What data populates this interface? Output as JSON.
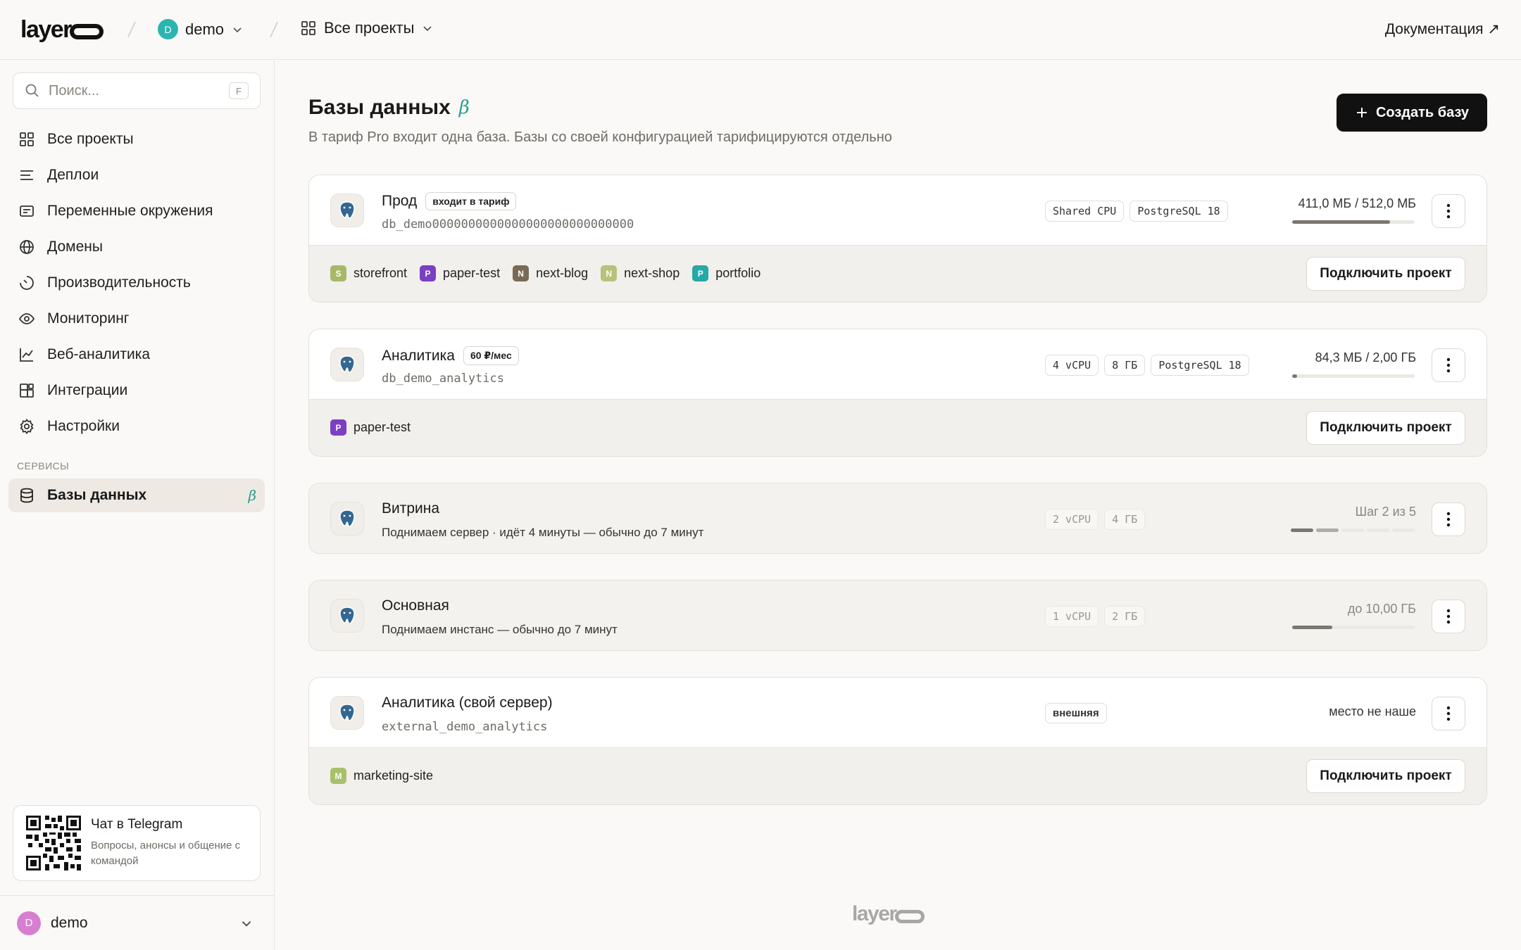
{
  "header": {
    "logo": "layero",
    "workspace": {
      "initial": "D",
      "name": "demo",
      "color": "#2bb5b0"
    },
    "projects_label": "Все проекты",
    "docs_label": "Документация ↗"
  },
  "sidebar": {
    "search_placeholder": "Поиск...",
    "search_shortcut": "F",
    "items": [
      {
        "label": "Все проекты",
        "icon": "grid-icon"
      },
      {
        "label": "Деплои",
        "icon": "list-icon"
      },
      {
        "label": "Переменные окружения",
        "icon": "env-icon"
      },
      {
        "label": "Домены",
        "icon": "globe-icon"
      },
      {
        "label": "Производительность",
        "icon": "gauge-icon"
      },
      {
        "label": "Мониторинг",
        "icon": "eye-icon"
      },
      {
        "label": "Веб-аналитика",
        "icon": "chart-icon"
      },
      {
        "label": "Интеграции",
        "icon": "integrations-icon"
      },
      {
        "label": "Настройки",
        "icon": "gear-icon"
      }
    ],
    "section_label": "СЕРВИСЫ",
    "active_item": {
      "label": "Базы данных",
      "beta": "β",
      "icon": "database-icon"
    },
    "telegram": {
      "title": "Чат в Telegram",
      "subtitle": "Вопросы, анонсы и общение с командой"
    },
    "user": {
      "initial": "D",
      "name": "demo",
      "color": "#d67fd0"
    }
  },
  "main": {
    "title": "Базы данных",
    "beta": "β",
    "subtitle": "В тариф Pro входит одна база. Базы со своей конфигурацией тарифицируются отдельно",
    "create_label": "Создать базу",
    "connect_label": "Подключить проект",
    "databases": [
      {
        "name": "Прод",
        "badge": "входит в тариф",
        "db_id": "db_demo0000000000000000000000000000",
        "tags": [
          "Shared CPU",
          "PostgreSQL 18"
        ],
        "usage": "411,0 МБ / 512,0 МБ",
        "usage_fraction": 0.8,
        "projects": [
          {
            "initial": "S",
            "name": "storefront",
            "color": "#a8b86a"
          },
          {
            "initial": "P",
            "name": "paper-test",
            "color": "#7b3fc4"
          },
          {
            "initial": "N",
            "name": "next-blog",
            "color": "#7a6a55"
          },
          {
            "initial": "N",
            "name": "next-shop",
            "color": "#b8c27a"
          },
          {
            "initial": "P",
            "name": "portfolio",
            "color": "#25a9a6"
          }
        ]
      },
      {
        "name": "Аналитика",
        "badge": "60 ₽/мес",
        "db_id": "db_demo_analytics",
        "tags": [
          "4 vCPU",
          "8 ГБ",
          "PostgreSQL 18"
        ],
        "usage": "84,3 МБ / 2,00 ГБ",
        "usage_fraction": 0.04,
        "projects": [
          {
            "initial": "P",
            "name": "paper-test",
            "color": "#7b3fc4"
          }
        ]
      },
      {
        "name": "Витрина",
        "status": "Поднимаем сервер · идёт 4 минуты — обычно до 7 минут",
        "tags": [
          "2 vCPU",
          "4 ГБ"
        ],
        "usage": "Шаг 2 из 5",
        "step": 2,
        "steps_total": 5
      },
      {
        "name": "Основная",
        "status": "Поднимаем инстанс — обычно до 7 минут",
        "tags": [
          "1 vCPU",
          "2 ГБ"
        ],
        "usage": "до 10,00 ГБ",
        "usage_fraction": 0.33
      },
      {
        "name": "Аналитика (свой сервер)",
        "db_id": "external_demo_analytics",
        "tags": [
          "внешняя"
        ],
        "usage": "место не наше",
        "projects": [
          {
            "initial": "M",
            "name": "marketing-site",
            "color": "#a8c06a"
          }
        ]
      }
    ]
  },
  "footer": {
    "logo": "layero"
  }
}
